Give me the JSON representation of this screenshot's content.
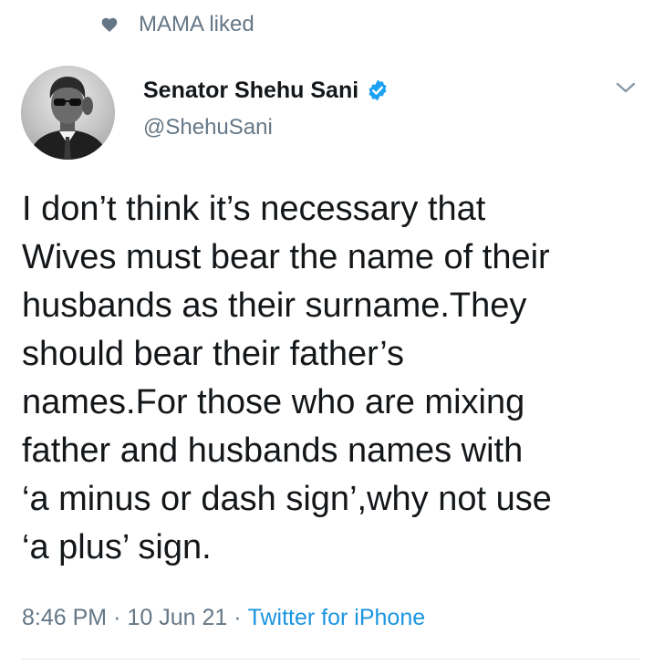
{
  "social_context": {
    "icon": "heart-icon",
    "text": "MAMA liked"
  },
  "author": {
    "name": "Senator Shehu Sani",
    "handle": "@ShehuSani",
    "verified": true,
    "verified_color": "#1da1f2"
  },
  "tweet": {
    "text": "I don’t think it’s necessary that\nWives must bear the name of their\nhusbands as their surname.They\nshould bear their father’s\nnames.For those who are mixing\nfather and husbands names with\n‘a minus or dash sign’,why not use\n‘a plus’ sign.",
    "time": "8:46 PM",
    "date": "10 Jun 21",
    "source": "Twitter for iPhone",
    "separator": "·"
  },
  "colors": {
    "text": "#14171a",
    "muted": "#657786",
    "link": "#1b95e0",
    "divider": "#e1e8ed"
  }
}
